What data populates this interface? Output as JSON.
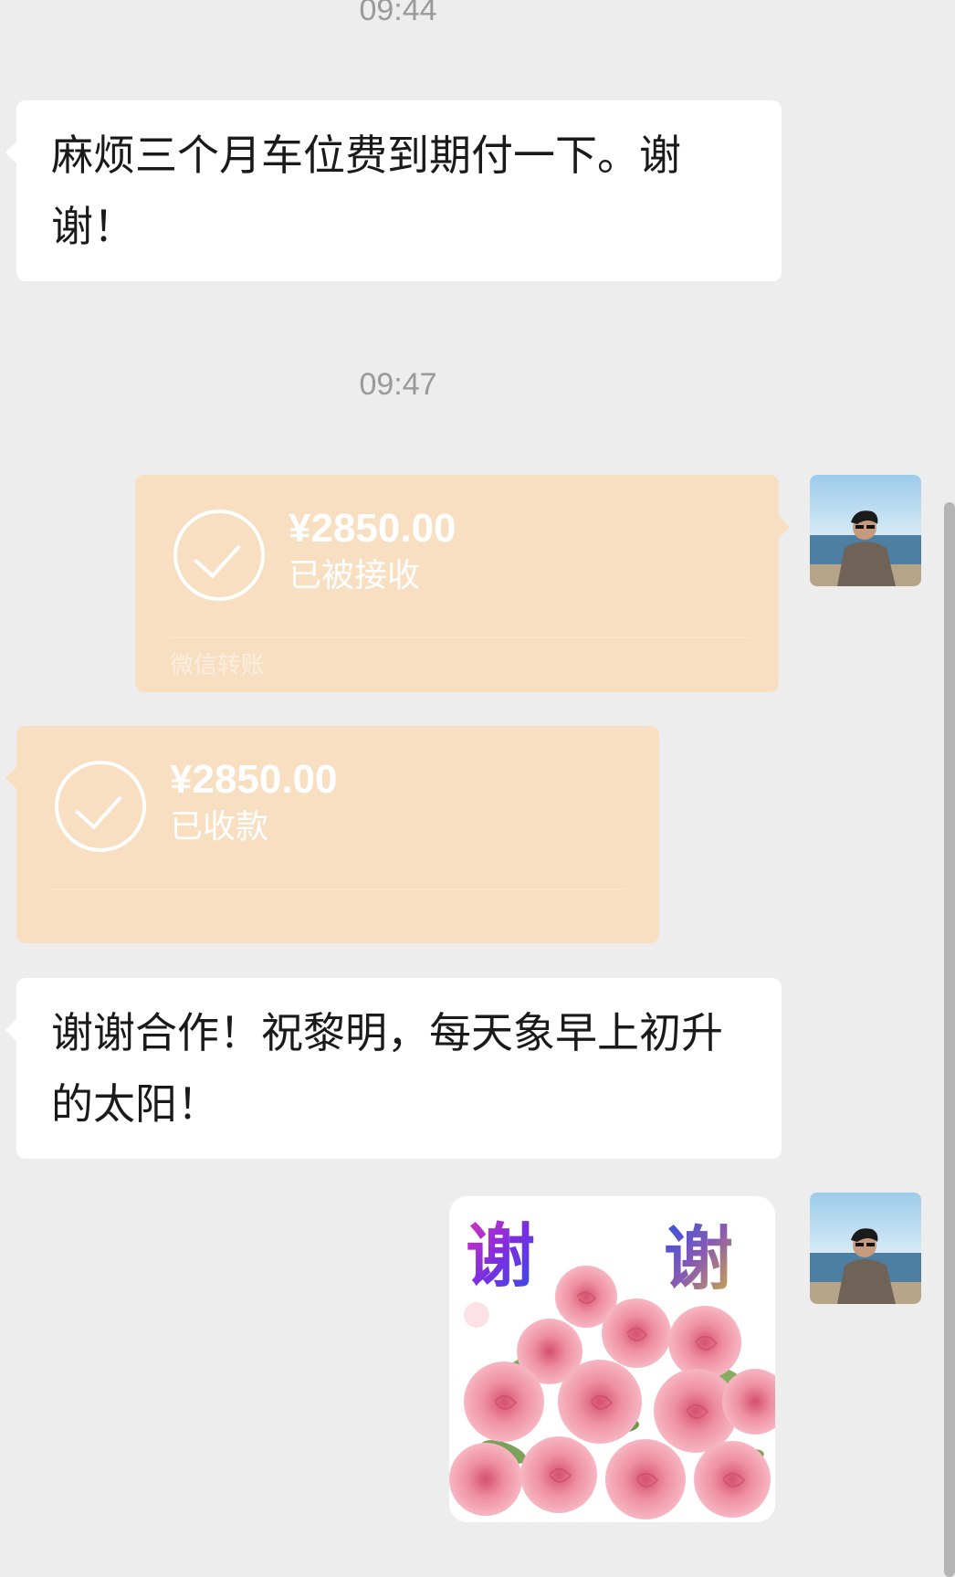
{
  "timestamps": [
    "09:44",
    "09:47"
  ],
  "messages": {
    "m1_text": "麻烦三个月车位费到期付一下。谢谢！",
    "m4_text": "谢谢合作！祝黎明，每天象早上初升的太阳！"
  },
  "transfer_sent": {
    "amount": "¥2850.00",
    "status": "已被接收",
    "footer": "微信转账"
  },
  "transfer_received": {
    "amount": "¥2850.00",
    "status": "已收款"
  },
  "sticker": {
    "left_char": "谢",
    "right_char": "谢",
    "icon": "rose-bouquet-icon"
  },
  "colors": {
    "background": "#ededed",
    "bubble": "#ffffff",
    "transfer": "#f8dfc1"
  }
}
